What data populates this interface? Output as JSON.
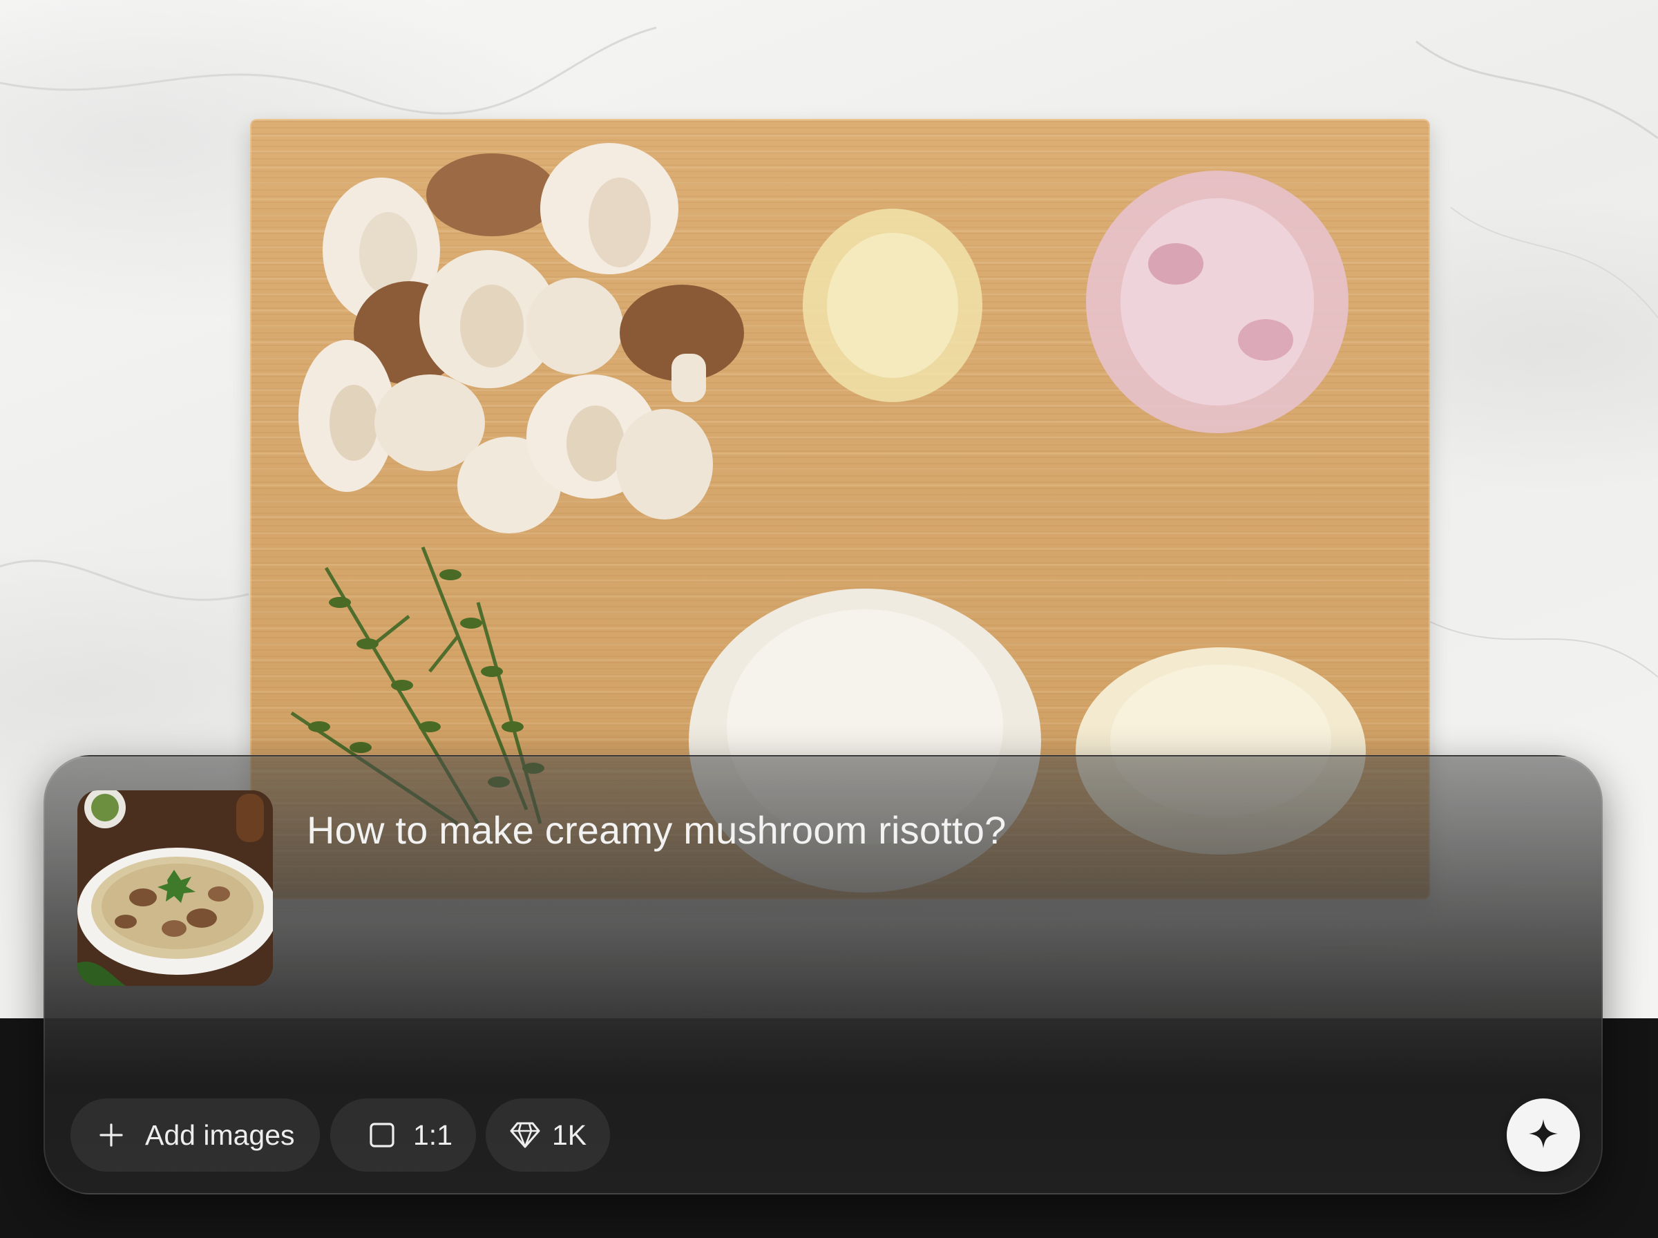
{
  "composer": {
    "prompt": "How to make creamy mushroom risotto?",
    "attachment_icon": "risotto-photo",
    "add_images_label": "Add images",
    "aspect_ratio_label": "1:1",
    "resolution_label": "1K",
    "generate_icon": "sparkle-icon"
  },
  "background_image": {
    "subject": "mushroom-risotto-ingredients-on-cutting-board"
  },
  "colors": {
    "composer_bg": "#3a3a3a",
    "chip_bg": "#2c2c2c",
    "text": "#f2f2f2",
    "generate_button": "#f4f4f4",
    "bottom_bar": "#141414"
  }
}
